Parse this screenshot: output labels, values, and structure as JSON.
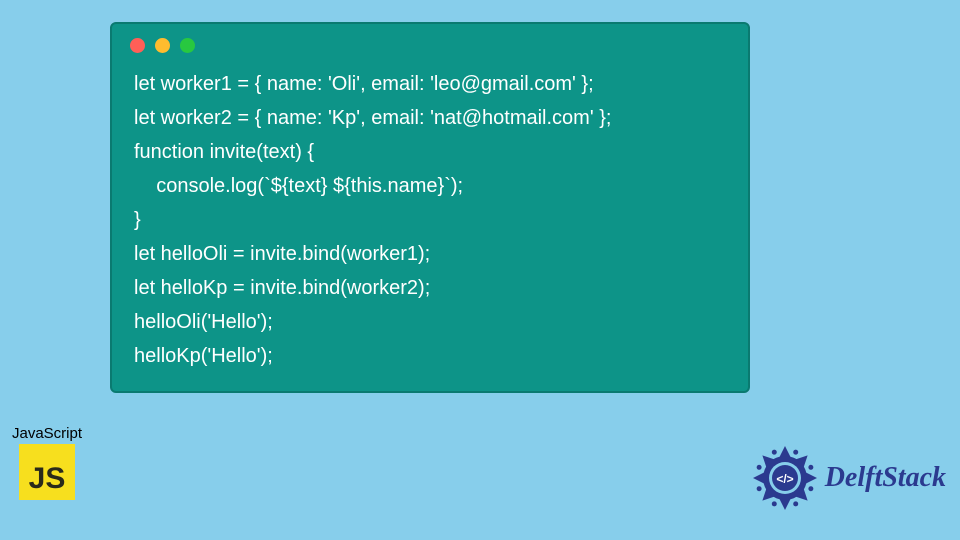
{
  "code": {
    "lines": [
      "let worker1 = { name: 'Oli', email: 'leo@gmail.com' };",
      "let worker2 = { name: 'Kp', email: 'nat@hotmail.com' };",
      "function invite(text) {",
      "    console.log(`${text} ${this.name}`);",
      "}",
      "let helloOli = invite.bind(worker1);",
      "let helloKp = invite.bind(worker2);",
      "helloOli('Hello');",
      "helloKp('Hello');"
    ]
  },
  "badges": {
    "js_label": "JavaScript",
    "js_glyph": "JS",
    "delft_text": "DelftStack"
  },
  "colors": {
    "background": "#87ceeb",
    "window": "#0d9488",
    "js_yellow": "#f7df1e",
    "delft_blue": "#2b3a8f"
  }
}
